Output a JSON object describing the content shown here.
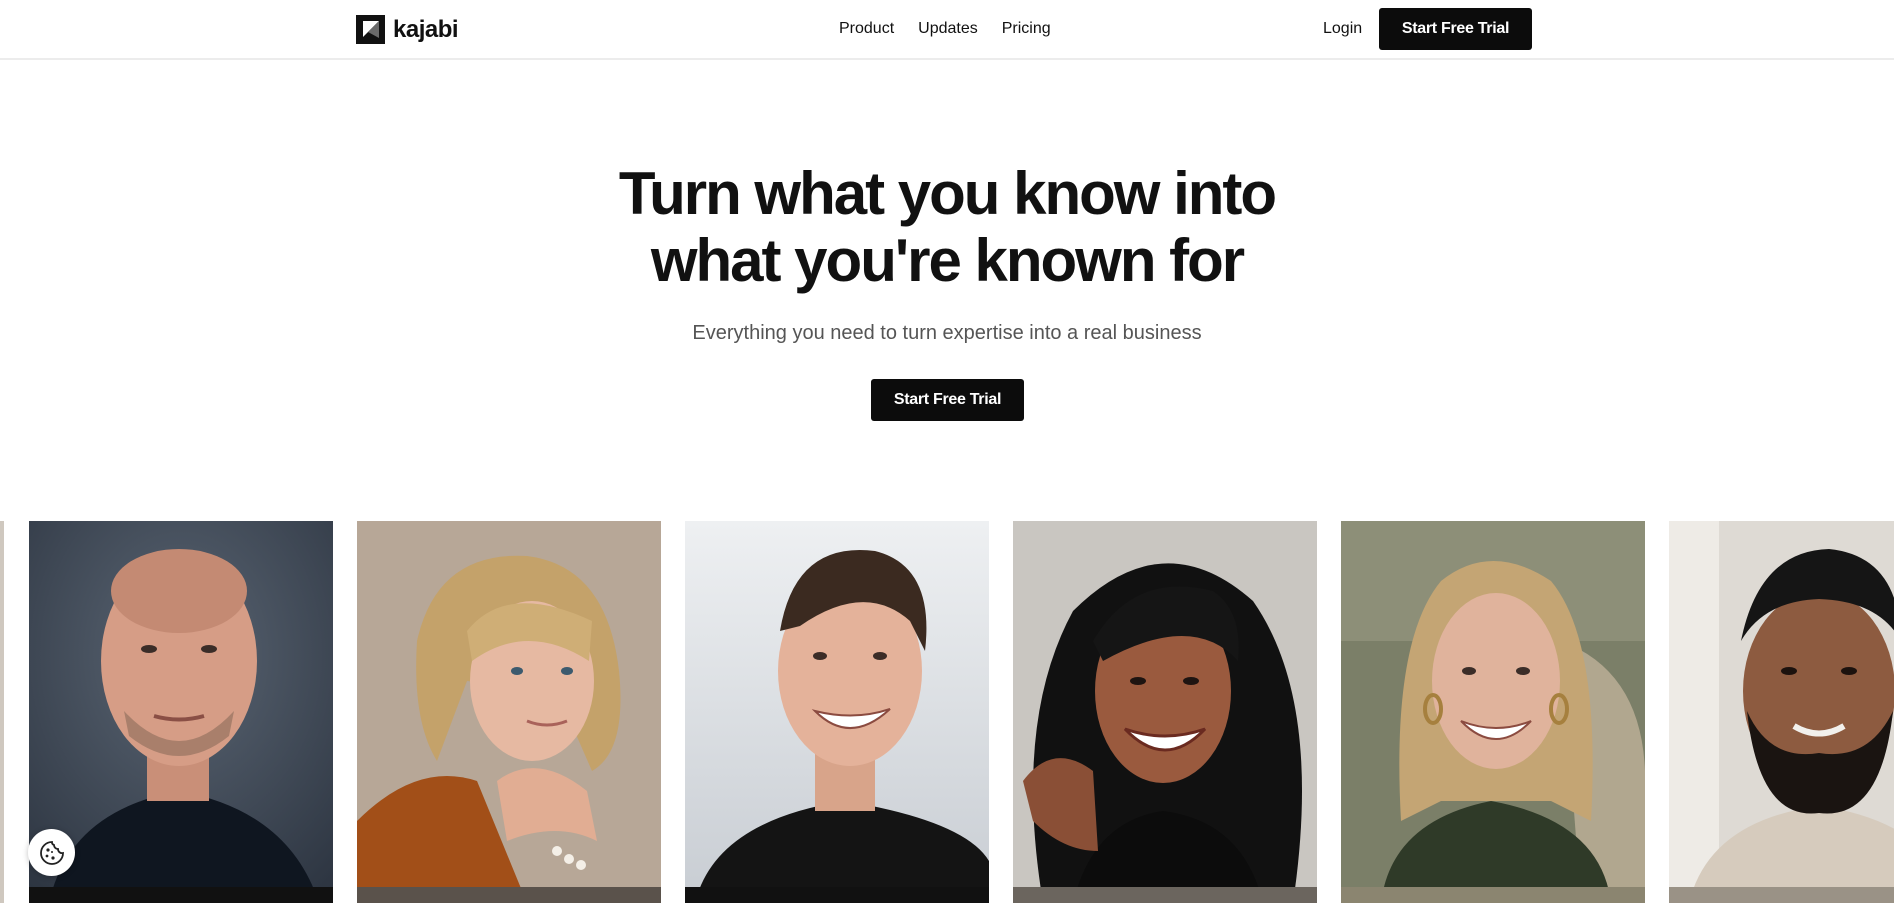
{
  "header": {
    "brand": "kajabi",
    "nav": [
      {
        "label": "Product"
      },
      {
        "label": "Updates"
      },
      {
        "label": "Pricing"
      }
    ],
    "login_label": "Login",
    "cta_label": "Start Free Trial"
  },
  "hero": {
    "title_line1": "Turn what you know into",
    "title_line2": "what you're known for",
    "subtitle": "Everything you need to turn expertise into a real business",
    "cta_label": "Start Free Trial"
  },
  "gallery": {
    "cards": [
      {
        "subject": "portrait-bald-man",
        "bg": "#3c4654"
      },
      {
        "subject": "portrait-blonde-woman",
        "bg": "#b6a696"
      },
      {
        "subject": "portrait-smiling-man",
        "bg": "#e3e6ea"
      },
      {
        "subject": "portrait-curly-hair-woman",
        "bg": "#c9c6c1"
      },
      {
        "subject": "portrait-long-hair-woman",
        "bg": "#6f7460"
      },
      {
        "subject": "portrait-bearded-man",
        "bg": "#d9d5cf"
      }
    ]
  },
  "cookie_widget": {
    "icon": "cookie-icon"
  },
  "colors": {
    "primary": "#0c0c0c",
    "text": "#111111",
    "muted": "#555555"
  }
}
